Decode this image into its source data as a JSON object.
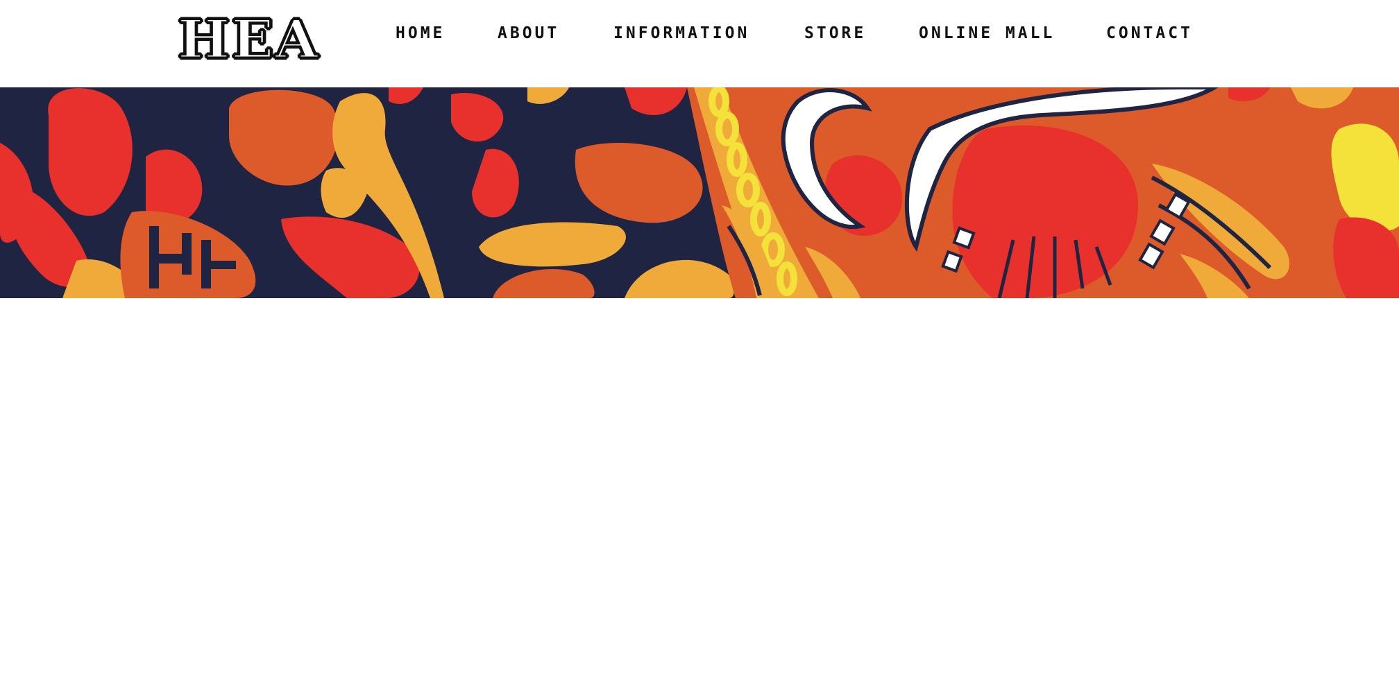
{
  "header": {
    "logo_text": "HEA"
  },
  "nav": {
    "items": [
      {
        "label": "HOME"
      },
      {
        "label": "ABOUT"
      },
      {
        "label": "INFORMATION"
      },
      {
        "label": "STORE"
      },
      {
        "label": "ONLINE MALL"
      },
      {
        "label": "CONTACT"
      }
    ]
  },
  "banner": {
    "colors": {
      "navy": "#1f2443",
      "red": "#e8302c",
      "orange": "#dd5b2a",
      "amber": "#f0aa3a",
      "yellow": "#f4e23a",
      "white": "#ffffff"
    }
  }
}
